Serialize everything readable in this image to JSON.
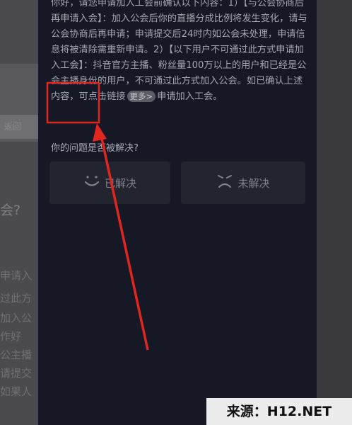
{
  "background_page": {
    "button_label": "返回",
    "heading": "会?",
    "lines": [
      "申请入",
      "过此方",
      "加入公",
      "作好",
      "公主播",
      "请提交",
      "如果人"
    ]
  },
  "faq": {
    "answer_lead": "你好，请您申请加入工会前确认以下内容：1）【与公会协商后再申请入会】：加入公会后你的直播分成比例将发生变化，请与公会协商后再申请；申请提交后24时内如公会未处理，申请信息将被清除需重新申请。2）【以下用户不可通过此方式申请加入工会】：抖音官方主播、粉丝量100万以上的用户和已经是公会主播身份的用户，不可通过此方式加入公会。如已确认上述内容，可点击链接",
    "more_chip": "更多>",
    "answer_tail": "申请加入工会。"
  },
  "feedback": {
    "question": "你的问题是否被解决?",
    "resolved": "已解决",
    "unresolved": "未解决",
    "resolved_icon": "smile-icon",
    "unresolved_icon": "frown-icon"
  },
  "watermark": "来源：H12.NET",
  "colors": {
    "panel": "#161825",
    "annotation": "#e0261f"
  }
}
